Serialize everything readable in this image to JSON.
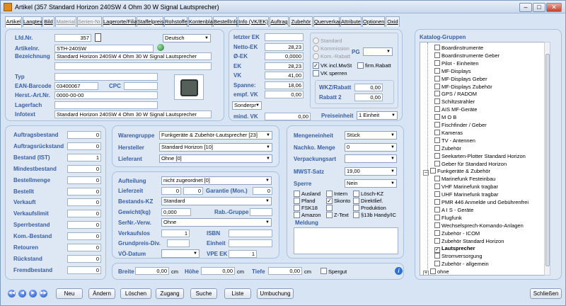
{
  "window": {
    "title": "Artikel (357  Standard Horizon 240SW  4 Ohm 30 W Signal Lautsprecher)"
  },
  "tabs": [
    {
      "label": "Artikel",
      "state": "active"
    },
    {
      "label": "Langtext",
      "state": "normal"
    },
    {
      "label": "Bild",
      "state": "normal"
    },
    {
      "label": "Material",
      "state": "disabled"
    },
    {
      "label": "Serien-Nr.",
      "state": "disabled"
    },
    {
      "label": "Lagerorte/Filialen",
      "state": "normal"
    },
    {
      "label": "Staffelpreise",
      "state": "normal"
    },
    {
      "label": "Rohstoffe",
      "state": "normal"
    },
    {
      "label": "Kontenblatt",
      "state": "normal"
    },
    {
      "label": "BestellInfo",
      "state": "normal"
    },
    {
      "label": "Info (VK/EK)",
      "state": "normal"
    },
    {
      "label": "Auftrag",
      "state": "normal"
    },
    {
      "label": "Zubehör",
      "state": "normal"
    },
    {
      "label": "Querverkauf",
      "state": "normal"
    },
    {
      "label": "Attribute",
      "state": "normal"
    },
    {
      "label": "Optionen",
      "state": "normal"
    },
    {
      "label": "Oxid",
      "state": "normal"
    }
  ],
  "main": {
    "lfdnr_label": "Lfd.Nr.",
    "lfdnr": "357",
    "lang": "Deutsch",
    "artikelnr_label": "Artikelnr.",
    "artikelnr": "STH-240SW",
    "bezeichnung_label": "Bezeichnung",
    "bezeichnung": "Standard Horizon 240SW  4 Ohm 30 W Signal Lautsprecher",
    "typ_label": "Typ",
    "typ": "",
    "ean_label": "EAN-Barcode",
    "ean": "03400067",
    "cpc_label": "CPC",
    "herst_label": "Herst.-Art.Nr.",
    "herst": "0000-00-00",
    "lagerfach_label": "Lagerfach",
    "lagerfach": "",
    "infotext_label": "Infotext",
    "infotext": "Standard Horizon 240SW  4 Ohm 30 W Signal Lautsprecher"
  },
  "pricing": {
    "letzter_ek_label": "letzter EK",
    "letzter_ek": "",
    "netto_ek_label": "Netto-EK",
    "netto_ek": "28,23",
    "d_ek_label": "Ø-EK",
    "d_ek": "0,0000",
    "ek_label": "EK",
    "ek": "28,23",
    "vk_label": "VK",
    "vk": "41,00",
    "spanne_label": "Spanne:",
    "spanne": "18,06",
    "empf_vk_label": "empf. VK",
    "empf_vk": "0,00",
    "sonder": "Sonderpr",
    "mind_vk_label": "mind. VK",
    "mind_vk": "0,00",
    "radio_standard": "Standard",
    "radio_kommission": "Kommission",
    "radio_komrabatt": "Kom.-Rabatt",
    "pg_label": "PG",
    "vk_incl": "VK incl.MwSt",
    "vk_incl_checked": true,
    "firm_rabatt": "firm.Rabatt",
    "vk_sperren": "VK sperren",
    "wkz_label": "WKZ/Rabatt",
    "wkz": "0,00",
    "rabatt2_label": "Rabatt 2",
    "rabatt2": "0,00",
    "preiseinheit_label": "Preiseinheit",
    "preiseinheit": "1 Einheit"
  },
  "stock": [
    {
      "label": "Auftragsbestand",
      "value": "0"
    },
    {
      "label": "Auftragsrückstand",
      "value": "0"
    },
    {
      "label": "Bestand (IST)",
      "value": "1"
    },
    {
      "label": "Mindestbestand",
      "value": "0"
    },
    {
      "label": "Bestellmenge",
      "value": "0"
    },
    {
      "label": "Bestellt",
      "value": "0"
    },
    {
      "label": "Verkauft",
      "value": "0"
    },
    {
      "label": "Verkaufslimit",
      "value": "0"
    },
    {
      "label": "Sperrbestand",
      "value": "0"
    },
    {
      "label": "Kom.-Bestand",
      "value": "0"
    },
    {
      "label": "Retouren",
      "value": "0"
    },
    {
      "label": "Rückstand",
      "value": "0"
    },
    {
      "label": "Fremdbestand",
      "value": "0"
    }
  ],
  "classification": {
    "warengruppe_label": "Warengruppe",
    "warengruppe": "Funkgeräte & Zubehör-Lautsprecher [23]",
    "hersteller_label": "Hersteller",
    "hersteller": "Standard Horizon [10]",
    "lieferant_label": "Lieferant",
    "lieferant": "Ohne [0]"
  },
  "details": {
    "aufteilung_label": "Aufteilung",
    "aufteilung": "nicht zugeordnet [0]",
    "lieferzeit_label": "Lieferzeit",
    "lieferzeit_a": "0",
    "lieferzeit_b": "0",
    "garantie_label": "Garantie (Mon.)",
    "garantie": "0",
    "bestands_label": "Bestands-KZ",
    "bestands": "Standard",
    "gewicht_label": "Gewicht(kg)",
    "gewicht": "0,000",
    "rabgruppe_label": "Rab.-Gruppe",
    "rabgruppe": "",
    "sernr_label": "SerNr.-Verw.",
    "sernr": "Ohne",
    "verkaufslos_label": "Verkaufslos",
    "verkaufslos": "1",
    "isbn_label": "ISBN",
    "isbn": "",
    "grundpreis_label": "Grundpreis-Div.",
    "grundpreis": "",
    "einheit_label": "Einheit",
    "einheit": "",
    "vodatum_label": "VÖ-Datum",
    "vodatum": "",
    "vpe_label": "VPE EK",
    "vpe": "1"
  },
  "units": {
    "mengeneinheit_label": "Mengeneinheit",
    "mengeneinheit": "Stück",
    "nachko_label": "Nachko. Menge",
    "nachko": "0",
    "verpackung_label": "Verpackungsart",
    "verpackung": "",
    "mwst_label": "MWST-Satz",
    "mwst": "19,00",
    "sperre_label": "Sperre",
    "sperre": "Nein"
  },
  "flags": [
    {
      "label": "Ausland",
      "checked": false
    },
    {
      "label": "Intern",
      "checked": false
    },
    {
      "label": "Lösch-KZ",
      "checked": false
    },
    {
      "label": "Pfand",
      "checked": false
    },
    {
      "label": "Skonto",
      "checked": true
    },
    {
      "label": "Direktlief.",
      "checked": false
    },
    {
      "label": "FSK18",
      "checked": false
    },
    {
      "label": "",
      "checked": false
    },
    {
      "label": "Produktion",
      "checked": false
    },
    {
      "label": "Amazon",
      "checked": false
    },
    {
      "label": "Z-Text",
      "checked": false
    },
    {
      "label": "§13b Handy/IC",
      "checked": false
    }
  ],
  "meldung_label": "Meldung",
  "dimensions": {
    "breite_label": "Breite",
    "breite": "0,00",
    "hoehe_label": "Höhe",
    "hoehe": "0,00",
    "tiefe_label": "Tiefe",
    "tiefe": "0,00",
    "unit": "cm",
    "spergut": "Spergut"
  },
  "catalog": {
    "title": "Katalog-Gruppen",
    "items": [
      {
        "label": "Boardinstrumente",
        "checked": false,
        "level": 2
      },
      {
        "label": "Boardinstrumente Geber",
        "checked": false,
        "level": 2
      },
      {
        "label": "Pilot - Einheiten",
        "checked": false,
        "level": 2
      },
      {
        "label": "MF-Displays",
        "checked": false,
        "level": 2
      },
      {
        "label": "MF-Displays Geber",
        "checked": false,
        "level": 2
      },
      {
        "label": "MF-Displays Zubehör",
        "checked": false,
        "level": 2
      },
      {
        "label": "GPS / RADOM",
        "checked": false,
        "level": 2
      },
      {
        "label": "Schiltzstrahler",
        "checked": false,
        "level": 2
      },
      {
        "label": "AIS MF-Geräte",
        "checked": false,
        "level": 2
      },
      {
        "label": "M O B",
        "checked": false,
        "level": 2
      },
      {
        "label": "Fischfinder / Geber",
        "checked": false,
        "level": 2
      },
      {
        "label": "Kameras",
        "checked": false,
        "level": 2
      },
      {
        "label": "TV - Antennen",
        "checked": false,
        "level": 2
      },
      {
        "label": "Zubehör",
        "checked": false,
        "level": 2
      },
      {
        "label": "Seekarten-Plotter Standard Horizon",
        "checked": false,
        "level": 2
      },
      {
        "label": "Geber für Standard Horizon",
        "checked": false,
        "level": 2
      },
      {
        "label": "Funkgeräte & Zubehör",
        "checked": false,
        "level": 1
      },
      {
        "label": "Marinefunk Festeinbau",
        "checked": false,
        "level": 2
      },
      {
        "label": "VHF Marinefunk tragbar",
        "checked": false,
        "level": 2
      },
      {
        "label": "UHF Marinefunk tragbar",
        "checked": false,
        "level": 2
      },
      {
        "label": "PMR 446 Anmelde und Gebührenfrei",
        "checked": false,
        "level": 2
      },
      {
        "label": "A I S - Geräte",
        "checked": false,
        "level": 2
      },
      {
        "label": "Flugfunk",
        "checked": false,
        "level": 2
      },
      {
        "label": "Wechselsprech-Komando-Anlagen",
        "checked": false,
        "level": 2
      },
      {
        "label": "Zubehör - ICOM",
        "checked": false,
        "level": 2
      },
      {
        "label": "Zubehör Standard Horizon",
        "checked": false,
        "level": 2
      },
      {
        "label": "Lautsprecher",
        "checked": true,
        "level": 2
      },
      {
        "label": "Stromversorgung",
        "checked": false,
        "level": 2
      },
      {
        "label": "Zubehör - allgemein",
        "checked": false,
        "level": 2
      },
      {
        "label": "ohne",
        "checked": false,
        "level": 1
      }
    ]
  },
  "buttons": {
    "neu": "Neu",
    "aendern": "Ändern",
    "loeschen": "Löschen",
    "zugang": "Zugang",
    "suche": "Suche",
    "liste": "Liste",
    "umbuchung": "Umbuchung",
    "schliessen": "Schließen"
  },
  "colors": {
    "accent": "#3a5fa6",
    "panel": "#dde8f4",
    "window": "#d6e4f3"
  }
}
